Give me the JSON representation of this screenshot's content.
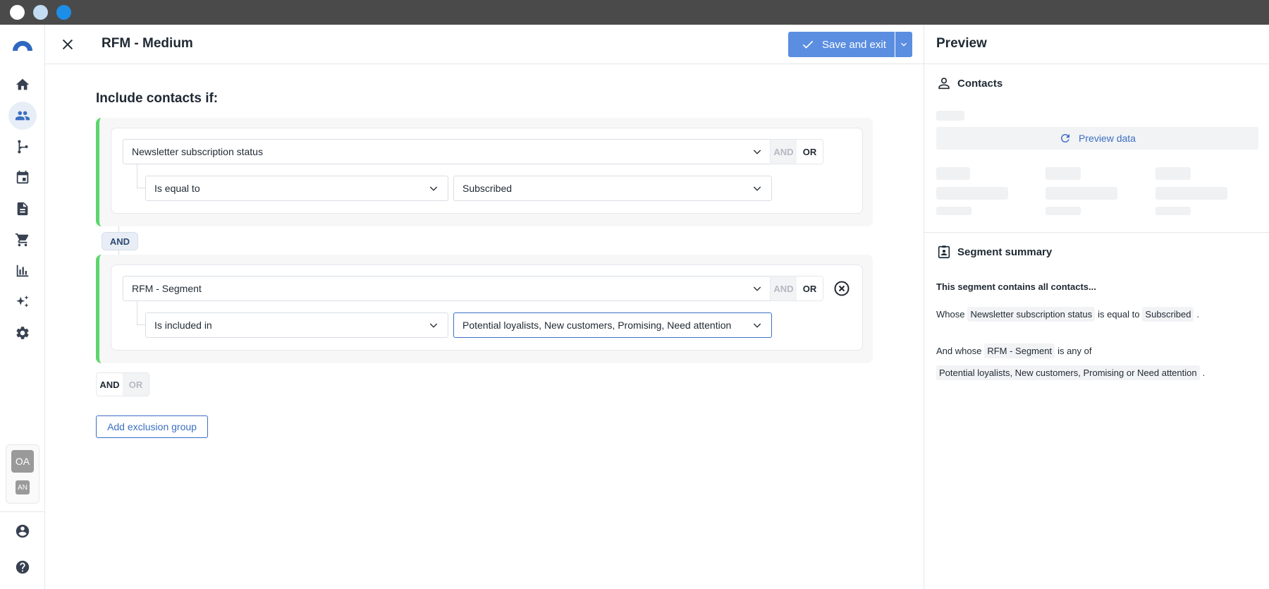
{
  "window": {
    "traffic_lights": [
      "#ffffff",
      "#c2dcf2",
      "#1e8de6"
    ]
  },
  "header": {
    "title": "RFM - Medium",
    "save_label": "Save and exit",
    "accent_color": "#5b8ee0"
  },
  "rail": {
    "items": [
      "logo-icon",
      "home-icon",
      "contacts-icon",
      "flow-icon",
      "calendar-icon",
      "document-icon",
      "cart-icon",
      "chart-icon",
      "sparkle-icon",
      "settings-icon"
    ],
    "active": "contacts-icon",
    "avatar_primary": "OA",
    "avatar_secondary": "AN"
  },
  "builder": {
    "section_title": "Include contacts if:",
    "groups": [
      {
        "field": "Newsletter subscription status",
        "operator": "Is equal to",
        "value": "Subscribed",
        "and_label": "AND",
        "or_label": "OR"
      },
      {
        "field": "RFM - Segment",
        "operator": "Is included in",
        "value": "Potential loyalists, New customers, Promising, Need attention",
        "and_label": "AND",
        "or_label": "OR"
      }
    ],
    "connector": "AND",
    "bottom_and": "AND",
    "bottom_or": "OR",
    "add_exclusion_label": "Add exclusion group"
  },
  "preview": {
    "title": "Preview",
    "contacts_label": "Contacts",
    "preview_data_label": "Preview data",
    "summary_title": "Segment summary",
    "summary_intro": "This segment contains all contacts...",
    "line1": {
      "prefix": "Whose",
      "field": "Newsletter subscription status",
      "op": "is equal to",
      "value": "Subscribed",
      "end": "."
    },
    "line2": {
      "prefix": "And whose",
      "field": "RFM - Segment",
      "op": "is any of",
      "value": "Potential loyalists, New customers, Promising or Need attention",
      "end": "."
    }
  }
}
